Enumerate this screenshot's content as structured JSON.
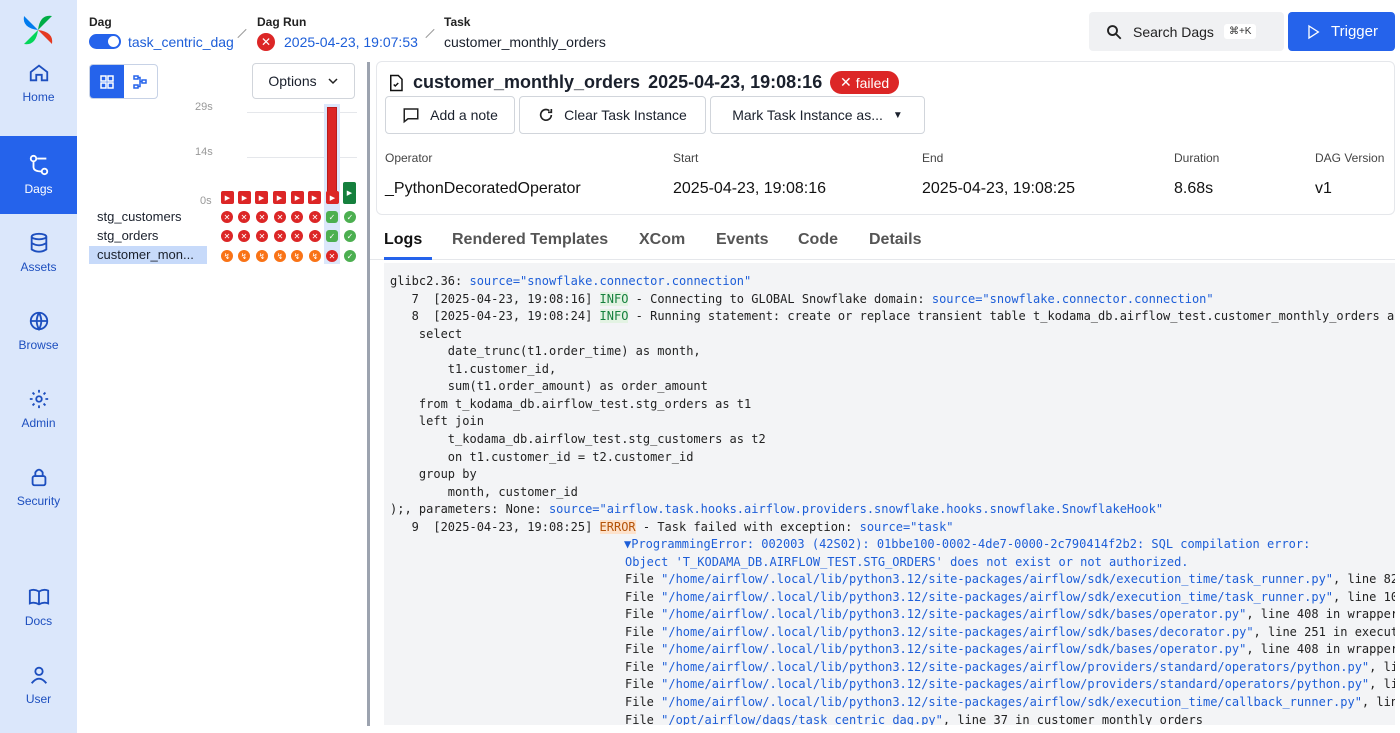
{
  "sidebar": {
    "items": [
      {
        "label": "Home",
        "icon": "home-icon"
      },
      {
        "label": "Dags",
        "icon": "dags-icon",
        "active": true
      },
      {
        "label": "Assets",
        "icon": "assets-icon"
      },
      {
        "label": "Browse",
        "icon": "browse-icon"
      },
      {
        "label": "Admin",
        "icon": "gear-icon"
      },
      {
        "label": "Security",
        "icon": "lock-icon"
      },
      {
        "label": "Docs",
        "icon": "book-icon"
      },
      {
        "label": "User",
        "icon": "user-icon"
      }
    ]
  },
  "header": {
    "dag_label": "Dag",
    "dag_value": "task_centric_dag",
    "dagrun_label": "Dag Run",
    "dagrun_value": "2025-04-23, 19:07:53",
    "task_label": "Task",
    "task_value": "customer_monthly_orders",
    "search_label": "Search Dags",
    "search_shortcut": "⌘+K",
    "trigger_label": "Trigger"
  },
  "grid": {
    "options_label": "Options",
    "axis": [
      "29s",
      "14s",
      "0s"
    ],
    "tasks": [
      {
        "name": "stg_customers",
        "selected": false
      },
      {
        "name": "stg_orders",
        "selected": false
      },
      {
        "name": "customer_mon...",
        "selected": true
      }
    ]
  },
  "task_instance": {
    "title": "customer_monthly_orders",
    "time": "2025-04-23, 19:08:16",
    "status": "failed",
    "actions": {
      "add_note": "Add a note",
      "clear": "Clear Task Instance",
      "mark": "Mark Task Instance as..."
    },
    "meta": {
      "operator_label": "Operator",
      "operator": "_PythonDecoratedOperator",
      "start_label": "Start",
      "start": "2025-04-23, 19:08:16",
      "end_label": "End",
      "end": "2025-04-23, 19:08:25",
      "duration_label": "Duration",
      "duration": "8.68s",
      "version_label": "DAG Version",
      "version": "v1"
    }
  },
  "tabs": [
    "Logs",
    "Rendered Templates",
    "XCom",
    "Events",
    "Code",
    "Details"
  ],
  "colors": {
    "accent": "#2563eb",
    "failed": "#dc2626",
    "success": "#4caf50",
    "upstream_failed": "#f97316"
  },
  "logs": {
    "l0": "glibc2.36: ",
    "l0src": "source=\"snowflake.connector.connection\"",
    "l7a": "   7  [2025-04-23, 19:08:16] ",
    "l7lvl": "INFO",
    "l7b": " - Connecting to GLOBAL Snowflake domain: ",
    "l7src": "source=\"snowflake.connector.connection\"",
    "l8a": "   8  [2025-04-23, 19:08:24] ",
    "l8lvl": "INFO",
    "l8b": " - Running statement: create or replace transient table t_kodama_db.airflow_test.customer_monthly_orders as",
    "sql1": "    select",
    "sql2": "        date_trunc(t1.order_time) as month,",
    "sql3": "        t1.customer_id,",
    "sql4": "        sum(t1.order_amount) as order_amount",
    "sql5": "    from t_kodama_db.airflow_test.stg_orders as t1",
    "sql6": "    left join",
    "sql7": "        t_kodama_db.airflow_test.stg_customers as t2",
    "sql8": "        on t1.customer_id = t2.customer_id",
    "sql9": "    group by",
    "sql10": "        month, customer_id",
    "params": ");, parameters: None: ",
    "params_src": "source=\"airflow.task.hooks.airflow.providers.snowflake.hooks.snowflake.SnowflakeHook\"",
    "l9a": "   9  [2025-04-23, 19:08:25] ",
    "l9lvl": "ERROR",
    "l9b": " - Task failed with exception: ",
    "l9src": "source=\"task\"",
    "exc1": "▼ProgrammingError: 002003 (42S02): 01bbe100-0002-4de7-0000-2c790414f2b2: SQL compilation error:",
    "exc2": "Object 'T_KODAMA_DB.AIRFLOW_TEST.STG_ORDERS' does not exist or not authorized.",
    "frames": [
      {
        "file": "\"/home/airflow/.local/lib/python3.12/site-packages/airflow/sdk/execution_time/task_runner.py\"",
        "rest": ", line 82"
      },
      {
        "file": "\"/home/airflow/.local/lib/python3.12/site-packages/airflow/sdk/execution_time/task_runner.py\"",
        "rest": ", line 10"
      },
      {
        "file": "\"/home/airflow/.local/lib/python3.12/site-packages/airflow/sdk/bases/operator.py\"",
        "rest": ", line 408 in wrapper"
      },
      {
        "file": "\"/home/airflow/.local/lib/python3.12/site-packages/airflow/sdk/bases/decorator.py\"",
        "rest": ", line 251 in execut"
      },
      {
        "file": "\"/home/airflow/.local/lib/python3.12/site-packages/airflow/sdk/bases/operator.py\"",
        "rest": ", line 408 in wrapper"
      },
      {
        "file": "\"/home/airflow/.local/lib/python3.12/site-packages/airflow/providers/standard/operators/python.py\"",
        "rest": ", li"
      },
      {
        "file": "\"/home/airflow/.local/lib/python3.12/site-packages/airflow/providers/standard/operators/python.py\"",
        "rest": ", li"
      },
      {
        "file": "\"/home/airflow/.local/lib/python3.12/site-packages/airflow/sdk/execution_time/callback_runner.py\"",
        "rest": ", lin"
      },
      {
        "file": "\"/opt/airflow/dags/task_centric_dag.py\"",
        "rest": ", line 37 in customer_monthly_orders"
      }
    ]
  }
}
